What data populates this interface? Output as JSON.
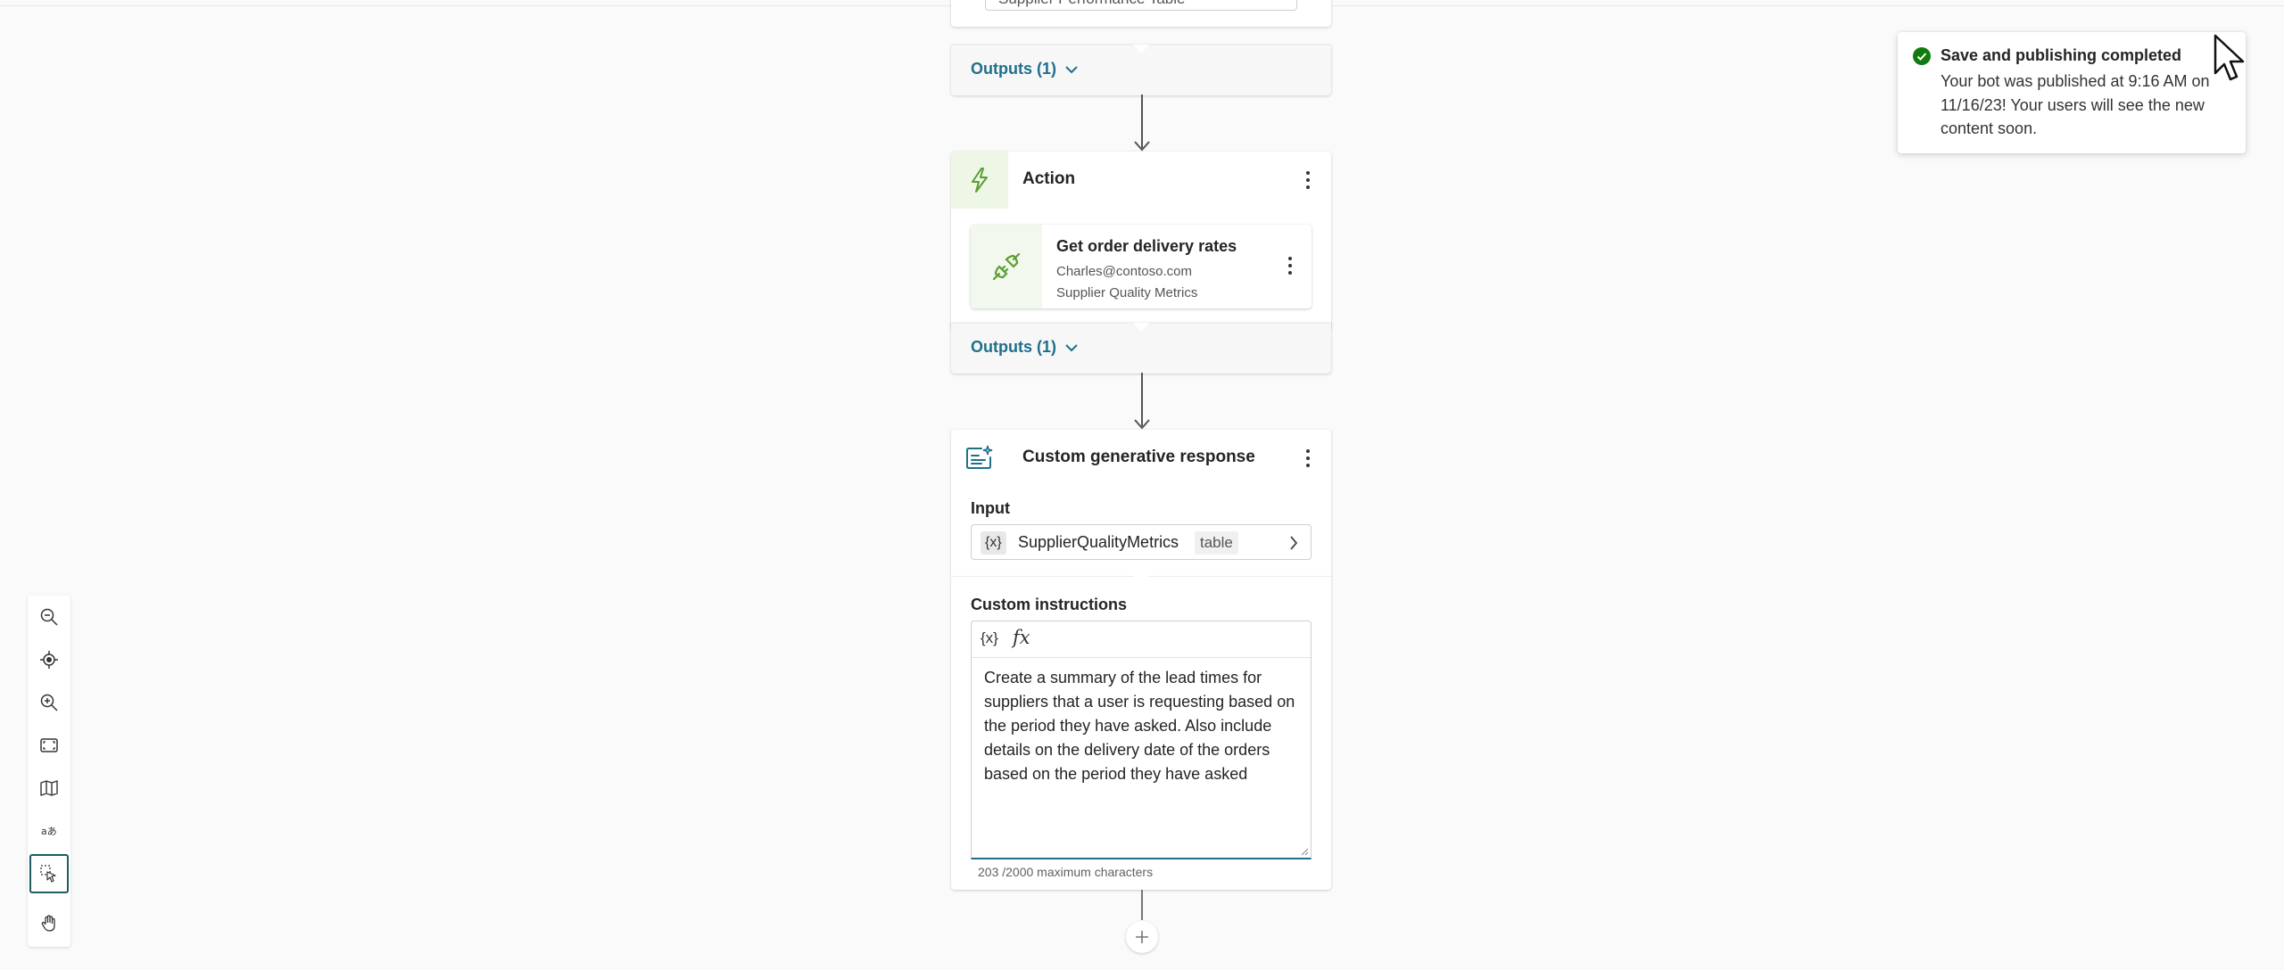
{
  "top_node": {
    "select_value": "Supplier Performance Table",
    "outputs_label": "Outputs (1)"
  },
  "action_node": {
    "title": "Action",
    "connector": {
      "title": "Get order delivery rates",
      "account": "Charles@contoso.com",
      "connection": "Supplier Quality Metrics"
    },
    "outputs_label": "Outputs (1)"
  },
  "generative_node": {
    "title": "Custom generative response",
    "input_label": "Input",
    "input_var_chip": "{x}",
    "input_var_name": "SupplierQualityMetrics",
    "input_var_type": "table",
    "instructions_label": "Custom instructions",
    "toolbar_var": "{x}",
    "toolbar_fx": "fx",
    "instructions_text": "Create a summary of the lead times for suppliers that a user is requesting based on the period they have asked. Also include details on the delivery date of the orders based on the period they have asked",
    "char_count": "203 /2000 maximum characters"
  },
  "toolbar": {
    "tools": [
      "zoom-out",
      "recenter",
      "zoom-in",
      "fit-to-screen",
      "minimap",
      "text-size",
      "select-mode",
      "pan-mode"
    ],
    "active": "select-mode"
  },
  "toast": {
    "title": "Save and publishing completed",
    "message": "Your bot was published at 9:16 AM on 11/16/23! Your users will see the new content soon.",
    "status_color": "#107c10"
  },
  "colors": {
    "accent": "#1f6f8b",
    "action_green": "#5a9e2f"
  }
}
